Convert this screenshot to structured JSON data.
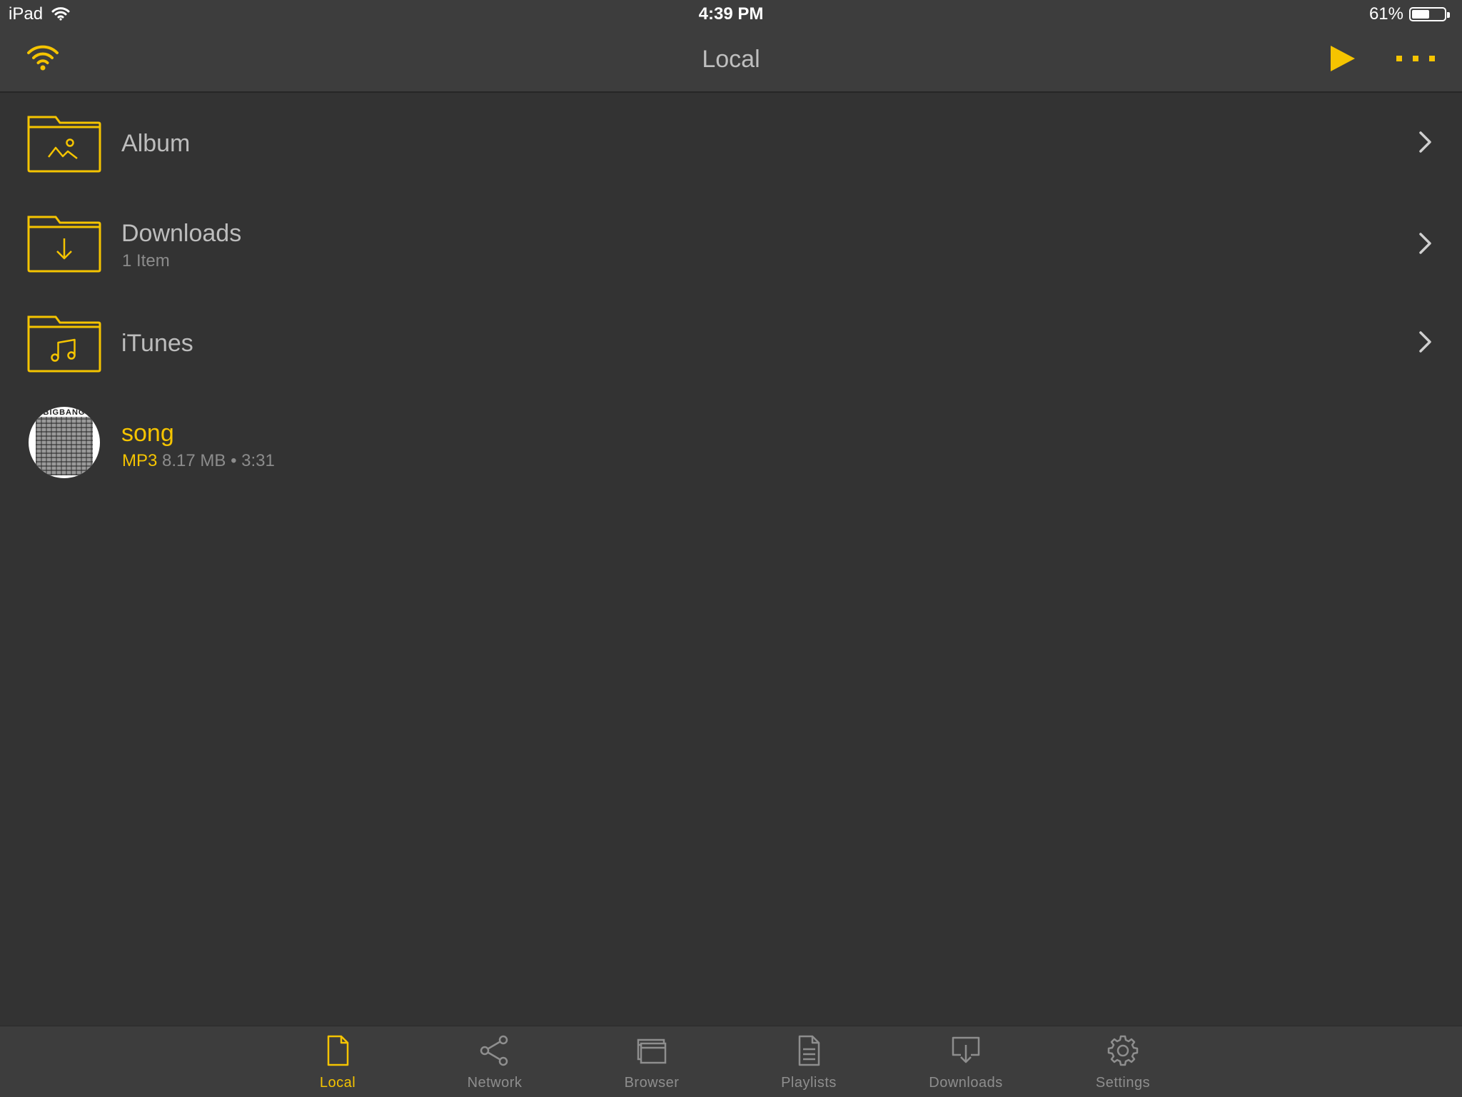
{
  "status_bar": {
    "device": "iPad",
    "time": "4:39 PM",
    "battery": "61%",
    "battery_level": 0.61
  },
  "nav": {
    "title": "Local",
    "left_icon": "wifi-icon",
    "right_icons": [
      "play-icon",
      "more-icon"
    ]
  },
  "colors": {
    "accent": "#f5c400",
    "background": "#333333",
    "bar": "#3d3d3d",
    "text": "#bdbdbd",
    "subtext": "#8c8c8c"
  },
  "list": {
    "folders": [
      {
        "name": "Album",
        "subtitle": "",
        "icon": "folder-image-icon"
      },
      {
        "name": "Downloads",
        "subtitle": "1 Item",
        "icon": "folder-download-icon"
      },
      {
        "name": "iTunes",
        "subtitle": "",
        "icon": "folder-music-icon"
      }
    ],
    "song": {
      "name": "song",
      "format": "MP3",
      "details": "8.17 MB • 3:31",
      "artwork_text": "BIGBANG"
    }
  },
  "tabs": [
    {
      "label": "Local",
      "icon": "document-icon",
      "active": true
    },
    {
      "label": "Network",
      "icon": "share-icon",
      "active": false
    },
    {
      "label": "Browser",
      "icon": "browser-window-icon",
      "active": false
    },
    {
      "label": "Playlists",
      "icon": "playlist-icon",
      "active": false
    },
    {
      "label": "Downloads",
      "icon": "download-tray-icon",
      "active": false
    },
    {
      "label": "Settings",
      "icon": "gear-icon",
      "active": false
    }
  ]
}
